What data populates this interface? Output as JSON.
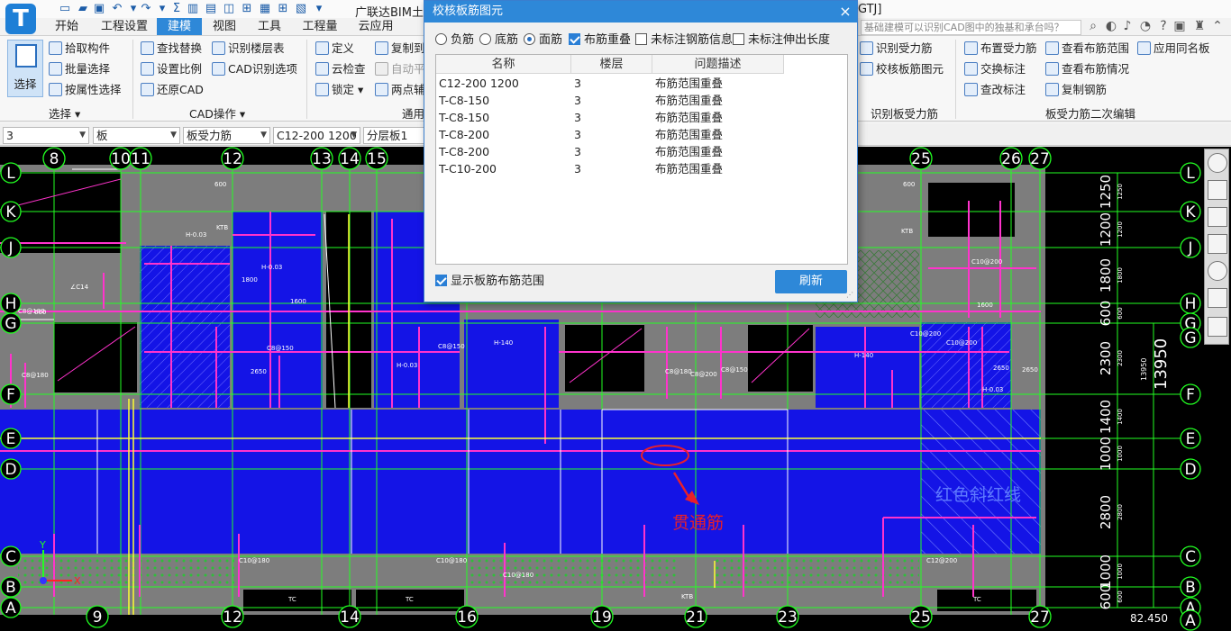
{
  "app": {
    "logo_letter": "T",
    "title": "广联达BIM土",
    "title_suffix": "GTJ]",
    "search_hint": "基础建模可以识别CAD图中的独基和承台吗？"
  },
  "tabs": [
    {
      "label": "开始"
    },
    {
      "label": "工程设置"
    },
    {
      "label": "建模",
      "active": true
    },
    {
      "label": "视图"
    },
    {
      "label": "工具"
    },
    {
      "label": "工程量"
    },
    {
      "label": "云应用"
    }
  ],
  "ribbon": {
    "select_label": "选择",
    "select_group_items": [
      "拾取构件",
      "批量选择",
      "按属性选择"
    ],
    "select_group_label": "选择",
    "cad_items": [
      "查找替换",
      "设置比例",
      "还原CAD",
      "识别楼层表",
      "CAD识别选项"
    ],
    "cad_group_label": "CAD操作",
    "common_items": [
      "定义",
      "云检查",
      "锁定",
      "复制到",
      "自动平",
      "两点辅"
    ],
    "common_group_label": "通用",
    "slab_identify_items": [
      "识别受力筋",
      "校核板筋图元"
    ],
    "slab_identify_group_label": "识别板受力筋",
    "slab_edit_items": [
      "布置受力筋",
      "交换标注",
      "查改标注",
      "查看布筋范围",
      "查看布筋情况",
      "复制钢筋",
      "应用同名板"
    ],
    "slab_edit_group_label": "板受力筋二次编辑"
  },
  "propbar": {
    "floor": "3",
    "category": "板",
    "type": "板受力筋",
    "element": "C12-200 1200",
    "layer": "分层板1"
  },
  "dialog": {
    "title": "校核板筋图元",
    "close": "×",
    "options": [
      {
        "label": "负筋",
        "kind": "radio",
        "checked": false
      },
      {
        "label": "底筋",
        "kind": "radio",
        "checked": false
      },
      {
        "label": "面筋",
        "kind": "radio",
        "checked": true
      },
      {
        "label": "布筋重叠",
        "kind": "check",
        "checked": true
      },
      {
        "label": "未标注钢筋信息",
        "kind": "check",
        "checked": false
      },
      {
        "label": "未标注伸出长度",
        "kind": "check",
        "checked": false
      }
    ],
    "columns": [
      "名称",
      "楼层",
      "问题描述"
    ],
    "rows": [
      {
        "name": "C12-200 1200",
        "floor": "3",
        "desc": "布筋范围重叠"
      },
      {
        "name": "T-C8-150",
        "floor": "3",
        "desc": "布筋范围重叠"
      },
      {
        "name": "T-C8-150",
        "floor": "3",
        "desc": "布筋范围重叠"
      },
      {
        "name": "T-C8-200",
        "floor": "3",
        "desc": "布筋范围重叠"
      },
      {
        "name": "T-C8-200",
        "floor": "3",
        "desc": "布筋范围重叠"
      },
      {
        "name": "T-C10-200",
        "floor": "3",
        "desc": "布筋范围重叠"
      }
    ],
    "show_range_label": "显示板筋布筋范围",
    "show_range_checked": true,
    "refresh_label": "刷新"
  },
  "drawing": {
    "top_axes": [
      "8",
      "10",
      "11",
      "12",
      "13",
      "14",
      "15",
      "25",
      "26",
      "27"
    ],
    "bottom_axes": [
      "9",
      "12",
      "14",
      "16",
      "19",
      "21",
      "23",
      "25",
      "27"
    ],
    "left_axes": [
      "L",
      "K",
      "J",
      "H",
      "G",
      "F",
      "E",
      "D",
      "C",
      "B",
      "A"
    ],
    "right_axes": [
      "L",
      "K",
      "J",
      "H",
      "G",
      "G",
      "F",
      "E",
      "D",
      "C",
      "B",
      "A",
      "A"
    ],
    "right_dims": [
      "1250",
      "1200",
      "1800",
      "600",
      "2300",
      "1400",
      "1000",
      "2800",
      "1000",
      "600"
    ],
    "right_dims_small": [
      "1250",
      "1200",
      "1800",
      "600",
      "2300",
      "1400",
      "1000",
      "2800",
      "1000",
      "600"
    ],
    "total_dim": "13950",
    "total_dim_small": "13950",
    "bottom_value": "82.450",
    "annot_red_text": "贯通筋",
    "annot_hatch_text": "红色斜红线",
    "small_labels": [
      "600",
      "600",
      "KTB",
      "KTB",
      "1600",
      "1600",
      "TC",
      "TC",
      "TC",
      "KTB",
      "C10@180",
      "C10@180",
      "C10@200",
      "C12@200",
      "C8@150",
      "C8@150",
      "H-140",
      "H-0.03",
      "H-0.03",
      "2650",
      "1800",
      "2650",
      "C8@180",
      "C8@180",
      "C8@150",
      "C8@200",
      "C10@180",
      "H-0.03",
      "H-140",
      "C10@200",
      "H-0.03",
      "2650",
      "C10@200",
      "∠C14",
      "600",
      "C8@180"
    ],
    "colors": {
      "slab": "#1414e6",
      "beam": "#ff33cc",
      "axis": "#22ff22",
      "wall": "#8c8c8c",
      "annotation": "#e8202a"
    }
  }
}
